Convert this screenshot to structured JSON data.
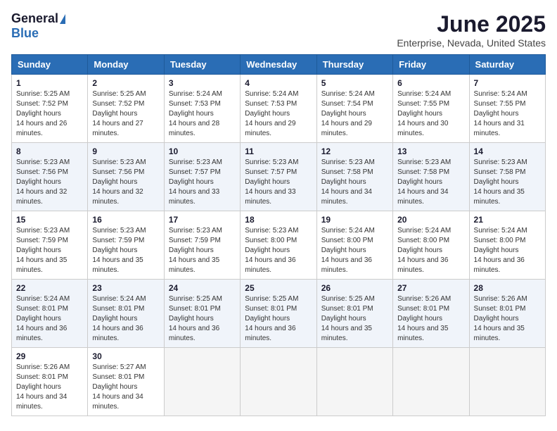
{
  "logo": {
    "general": "General",
    "blue": "Blue"
  },
  "title": "June 2025",
  "location": "Enterprise, Nevada, United States",
  "days_of_week": [
    "Sunday",
    "Monday",
    "Tuesday",
    "Wednesday",
    "Thursday",
    "Friday",
    "Saturday"
  ],
  "weeks": [
    [
      {
        "day": "1",
        "sunrise": "5:25 AM",
        "sunset": "7:52 PM",
        "daylight": "14 hours and 26 minutes."
      },
      {
        "day": "2",
        "sunrise": "5:25 AM",
        "sunset": "7:52 PM",
        "daylight": "14 hours and 27 minutes."
      },
      {
        "day": "3",
        "sunrise": "5:24 AM",
        "sunset": "7:53 PM",
        "daylight": "14 hours and 28 minutes."
      },
      {
        "day": "4",
        "sunrise": "5:24 AM",
        "sunset": "7:53 PM",
        "daylight": "14 hours and 29 minutes."
      },
      {
        "day": "5",
        "sunrise": "5:24 AM",
        "sunset": "7:54 PM",
        "daylight": "14 hours and 29 minutes."
      },
      {
        "day": "6",
        "sunrise": "5:24 AM",
        "sunset": "7:55 PM",
        "daylight": "14 hours and 30 minutes."
      },
      {
        "day": "7",
        "sunrise": "5:24 AM",
        "sunset": "7:55 PM",
        "daylight": "14 hours and 31 minutes."
      }
    ],
    [
      {
        "day": "8",
        "sunrise": "5:23 AM",
        "sunset": "7:56 PM",
        "daylight": "14 hours and 32 minutes."
      },
      {
        "day": "9",
        "sunrise": "5:23 AM",
        "sunset": "7:56 PM",
        "daylight": "14 hours and 32 minutes."
      },
      {
        "day": "10",
        "sunrise": "5:23 AM",
        "sunset": "7:57 PM",
        "daylight": "14 hours and 33 minutes."
      },
      {
        "day": "11",
        "sunrise": "5:23 AM",
        "sunset": "7:57 PM",
        "daylight": "14 hours and 33 minutes."
      },
      {
        "day": "12",
        "sunrise": "5:23 AM",
        "sunset": "7:58 PM",
        "daylight": "14 hours and 34 minutes."
      },
      {
        "day": "13",
        "sunrise": "5:23 AM",
        "sunset": "7:58 PM",
        "daylight": "14 hours and 34 minutes."
      },
      {
        "day": "14",
        "sunrise": "5:23 AM",
        "sunset": "7:58 PM",
        "daylight": "14 hours and 35 minutes."
      }
    ],
    [
      {
        "day": "15",
        "sunrise": "5:23 AM",
        "sunset": "7:59 PM",
        "daylight": "14 hours and 35 minutes."
      },
      {
        "day": "16",
        "sunrise": "5:23 AM",
        "sunset": "7:59 PM",
        "daylight": "14 hours and 35 minutes."
      },
      {
        "day": "17",
        "sunrise": "5:23 AM",
        "sunset": "7:59 PM",
        "daylight": "14 hours and 35 minutes."
      },
      {
        "day": "18",
        "sunrise": "5:23 AM",
        "sunset": "8:00 PM",
        "daylight": "14 hours and 36 minutes."
      },
      {
        "day": "19",
        "sunrise": "5:24 AM",
        "sunset": "8:00 PM",
        "daylight": "14 hours and 36 minutes."
      },
      {
        "day": "20",
        "sunrise": "5:24 AM",
        "sunset": "8:00 PM",
        "daylight": "14 hours and 36 minutes."
      },
      {
        "day": "21",
        "sunrise": "5:24 AM",
        "sunset": "8:00 PM",
        "daylight": "14 hours and 36 minutes."
      }
    ],
    [
      {
        "day": "22",
        "sunrise": "5:24 AM",
        "sunset": "8:01 PM",
        "daylight": "14 hours and 36 minutes."
      },
      {
        "day": "23",
        "sunrise": "5:24 AM",
        "sunset": "8:01 PM",
        "daylight": "14 hours and 36 minutes."
      },
      {
        "day": "24",
        "sunrise": "5:25 AM",
        "sunset": "8:01 PM",
        "daylight": "14 hours and 36 minutes."
      },
      {
        "day": "25",
        "sunrise": "5:25 AM",
        "sunset": "8:01 PM",
        "daylight": "14 hours and 36 minutes."
      },
      {
        "day": "26",
        "sunrise": "5:25 AM",
        "sunset": "8:01 PM",
        "daylight": "14 hours and 35 minutes."
      },
      {
        "day": "27",
        "sunrise": "5:26 AM",
        "sunset": "8:01 PM",
        "daylight": "14 hours and 35 minutes."
      },
      {
        "day": "28",
        "sunrise": "5:26 AM",
        "sunset": "8:01 PM",
        "daylight": "14 hours and 35 minutes."
      }
    ],
    [
      {
        "day": "29",
        "sunrise": "5:26 AM",
        "sunset": "8:01 PM",
        "daylight": "14 hours and 34 minutes."
      },
      {
        "day": "30",
        "sunrise": "5:27 AM",
        "sunset": "8:01 PM",
        "daylight": "14 hours and 34 minutes."
      },
      null,
      null,
      null,
      null,
      null
    ]
  ]
}
